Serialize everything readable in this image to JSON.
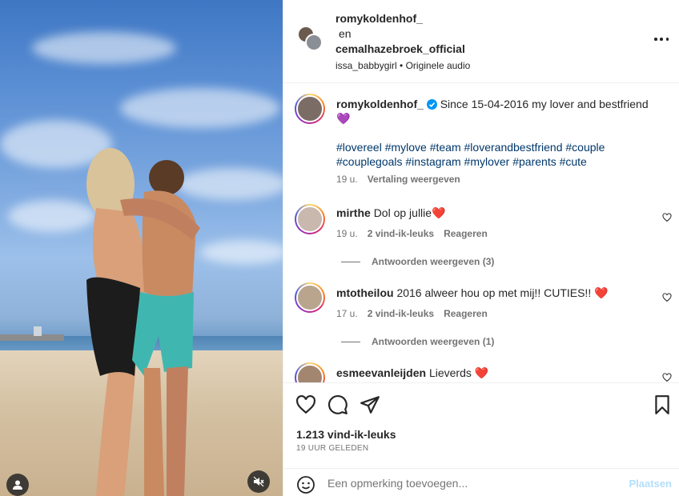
{
  "header": {
    "author": "romykoldenhof_",
    "joiner": "en",
    "coauthor": "cemalhazebroek_official",
    "audio_user": "issa_babbygirl",
    "audio_sep": " • ",
    "audio_label": "Originele audio"
  },
  "caption": {
    "username": "romykoldenhof_",
    "text": "Since 15-04-2016 my lover and bestfriend 💜",
    "hashtags": "#lovereel #mylove #team #loverandbestfriend #couple #couplegoals #instagram #mylover #parents #cute",
    "time": "19 u.",
    "translate": "Vertaling weergeven"
  },
  "comments": [
    {
      "username": "mirthe",
      "text": "Dol op jullie❤️",
      "time": "19 u.",
      "likes": "2 vind-ik-leuks",
      "reply": "Reageren",
      "view_replies": "Antwoorden weergeven (3)"
    },
    {
      "username": "mtotheilou",
      "text": "2016 alweer hou op met mij!! CUTIES!! ❤️",
      "time": "17 u.",
      "likes": "2 vind-ik-leuks",
      "reply": "Reageren",
      "view_replies": "Antwoorden weergeven (1)"
    },
    {
      "username": "esmeevanleijden",
      "text": "Lieverds ❤️"
    }
  ],
  "footer": {
    "likes": "1.213 vind-ik-leuks",
    "time": "19 UUR GELEDEN",
    "comment_placeholder": "Een opmerking toevoegen...",
    "post_label": "Plaatsen"
  },
  "icons": {
    "like": "heart-icon",
    "comment": "comment-icon",
    "share": "share-icon",
    "save": "bookmark-icon",
    "emoji": "emoji-icon",
    "user_tag": "user-tag-icon",
    "audio": "mute-icon",
    "more": "more-icon"
  },
  "colors": {
    "verified": "#0095f6",
    "link": "#00376b",
    "muted": "#737373",
    "post_disabled": "#b2dffc",
    "heart_red": "#ed4956"
  }
}
